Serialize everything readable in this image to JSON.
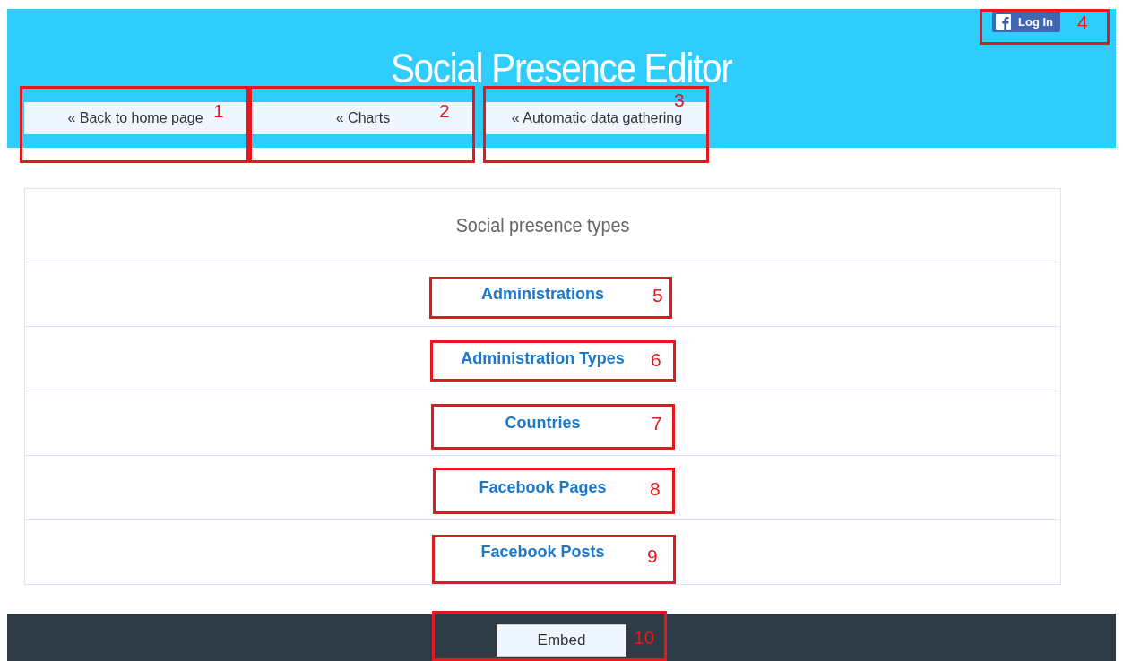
{
  "header": {
    "title": "Social Presence Editor",
    "login_button": "Log In"
  },
  "nav": [
    "« Back to home page",
    "« Charts",
    "« Automatic data gathering"
  ],
  "table": {
    "heading": "Social presence types",
    "rows": [
      "Administrations",
      "Administration Types",
      "Countries",
      "Facebook Pages",
      "Facebook Posts"
    ]
  },
  "footer": {
    "button": "Embed"
  },
  "annotations": [
    {
      "label": "1"
    },
    {
      "label": "2"
    },
    {
      "label": "3"
    },
    {
      "label": "4"
    },
    {
      "label": "5"
    },
    {
      "label": "6"
    },
    {
      "label": "7"
    },
    {
      "label": "8"
    },
    {
      "label": "9"
    },
    {
      "label": "10"
    }
  ]
}
